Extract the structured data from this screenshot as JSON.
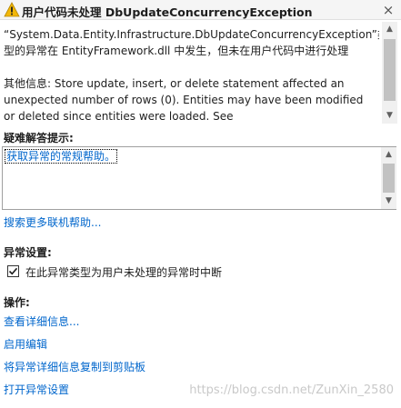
{
  "title": "用户代码未处理 DbUpdateConcurrencyException",
  "close_glyph": "×",
  "message": {
    "line1": "“System.Data.Entity.Infrastructure.DbUpdateConcurrencyException”类型的异常在 EntityFramework.dll 中发生，但未在用户代码中进行处理",
    "line2": "其他信息: Store update, insert, or delete statement affected an unexpected number of rows (0). Entities may have been modified or deleted since entities were loaded. See"
  },
  "troubleshooting": {
    "label": "疑难解答提示:",
    "tip_link": "获取异常的常规帮助。"
  },
  "search_online": "搜索更多联机帮助...",
  "exception_settings": {
    "label": "异常设置:",
    "checkbox_label": "在此异常类型为用户未处理的异常时中断",
    "checked": true
  },
  "actions": {
    "label": "操作:",
    "items": [
      "查看详细信息...",
      "启用编辑",
      "将异常详细信息复制到剪贴板",
      "打开异常设置"
    ]
  },
  "watermark": "https://blog.csdn.net/ZunXin_2580",
  "colors": {
    "link": "#0066cc",
    "warning": "#f2b707"
  },
  "icons": {
    "title": "warning-icon",
    "close": "close-icon",
    "check": "check-icon"
  }
}
